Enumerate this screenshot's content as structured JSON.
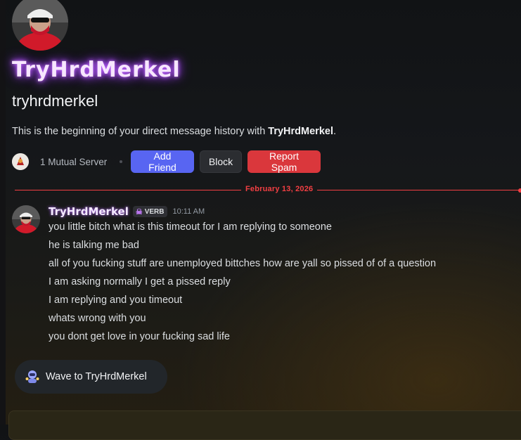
{
  "profile": {
    "display_name": "TryHrdMerkel",
    "username": "tryhrdmerkel",
    "intro_prefix": "This is the beginning of your direct message history with ",
    "intro_name": "TryHrdMerkel",
    "intro_suffix": ".",
    "mutual_servers": "1 Mutual Server"
  },
  "actions": {
    "add_friend": "Add Friend",
    "block": "Block",
    "report_spam": "Report Spam"
  },
  "divider": {
    "date": "February 13, 2026"
  },
  "message": {
    "author": "TryHrdMerkel",
    "tag": "VERB",
    "time": "10:11 AM",
    "lines": [
      "you little bitch what is this timeout for I am replying to someone",
      "he is talking me bad",
      "all of you fucking stuff are unemployed bittches how are yall so pissed of of a question",
      "I am asking normally I get a pissed reply",
      "I am replying and you timeout",
      "whats wrong with you",
      "you dont get love in your fucking sad life"
    ]
  },
  "wave": {
    "label": "Wave to TryHrdMerkel"
  },
  "colors": {
    "accent": "#5865f2",
    "danger": "#da373c",
    "divider": "#f23f43",
    "name_glow": "#b86bff"
  },
  "icons": {
    "avatar": "masked-person-avatar",
    "server": "server-icon",
    "tag": "skull-icon",
    "wave": "wave-bot-icon"
  }
}
